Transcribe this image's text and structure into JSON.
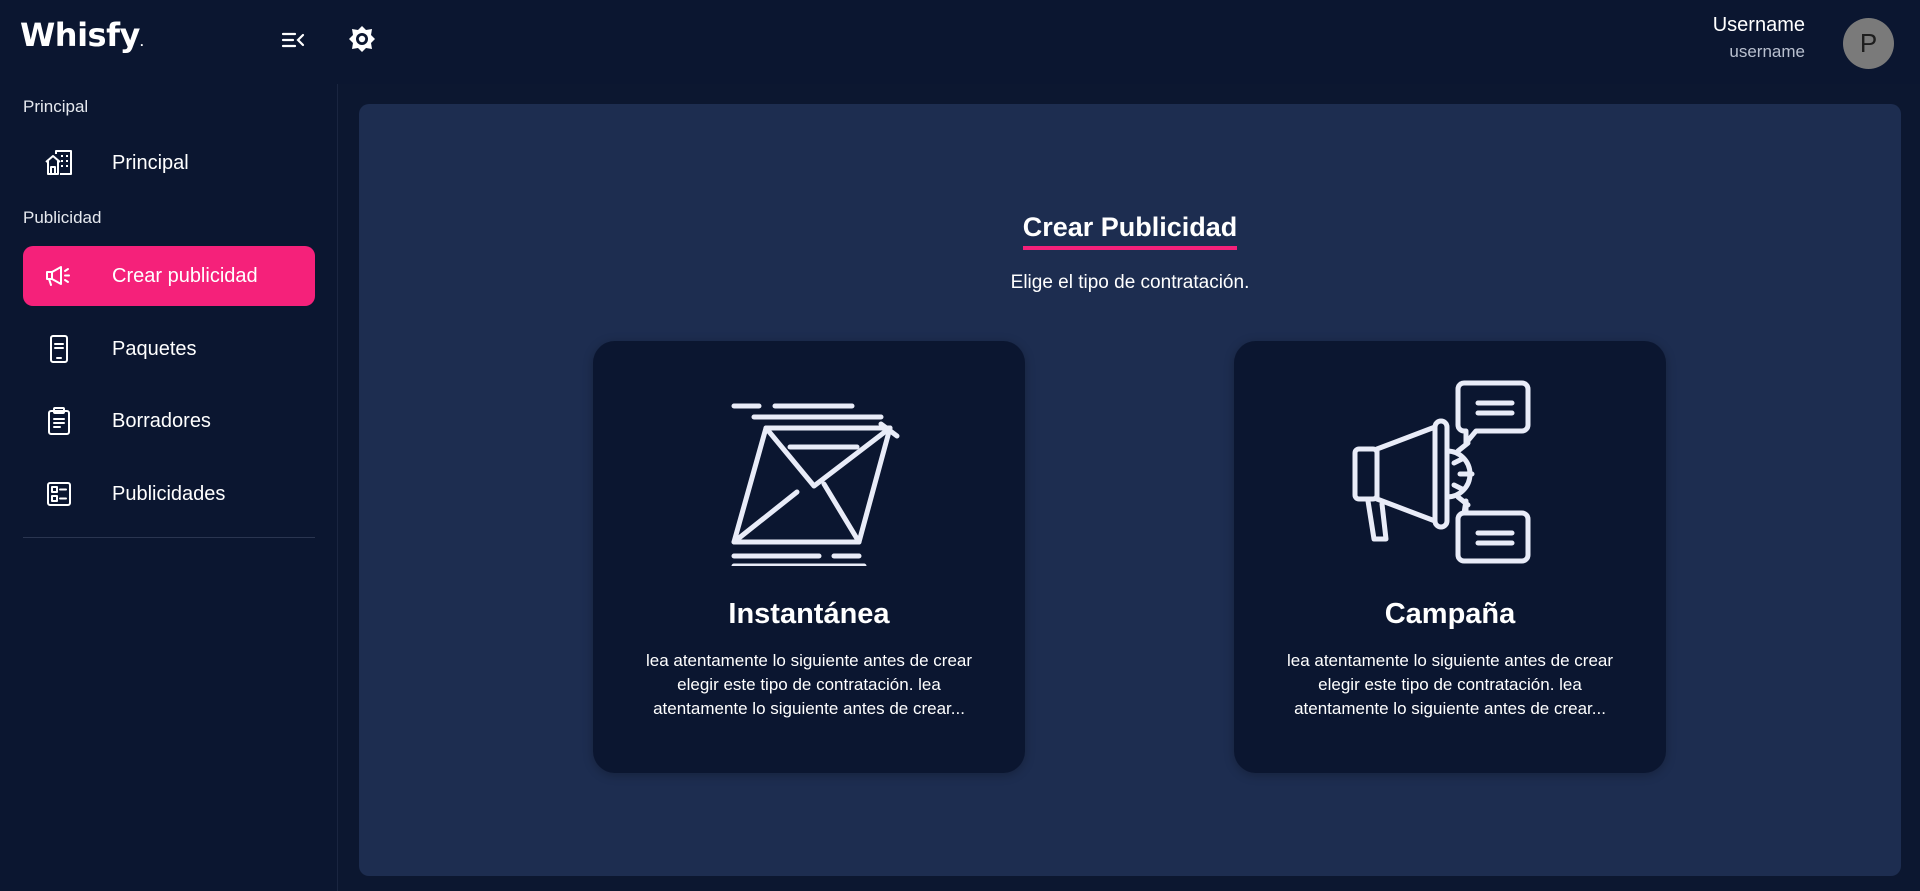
{
  "app": {
    "logo_text": "Whisfy",
    "logo_dot": "."
  },
  "header": {
    "menu_icon": "menu-collapse-icon",
    "theme_icon": "brightness-icon",
    "user_name": "Username",
    "user_handle": "username",
    "avatar_initial": "P"
  },
  "sidebar": {
    "sections": [
      {
        "label": "Principal"
      },
      {
        "label": "Publicidad"
      }
    ],
    "items": [
      {
        "label": "Principal",
        "icon": "home-building-icon",
        "active": false
      },
      {
        "label": "Crear publicidad",
        "icon": "megaphone-icon",
        "active": true
      },
      {
        "label": "Paquetes",
        "icon": "phone-document-icon",
        "active": false
      },
      {
        "label": "Borradores",
        "icon": "clipboard-icon",
        "active": false
      },
      {
        "label": "Publicidades",
        "icon": "list-checks-icon",
        "active": false
      }
    ]
  },
  "main": {
    "title": "Crear Publicidad",
    "subtitle": "Elige el tipo de contratación.",
    "cards": [
      {
        "title": "Instantánea",
        "icon": "envelope-fast-icon",
        "description": "lea atentamente lo siguiente antes de crear elegir este tipo de contratación. lea atentamente lo siguiente antes de crear..."
      },
      {
        "title": "Campaña",
        "icon": "megaphone-chat-icon",
        "description": "lea atentamente lo siguiente antes de crear elegir este tipo de contratación. lea atentamente lo siguiente antes de crear..."
      }
    ]
  },
  "colors": {
    "background": "#0b1630",
    "panel": "#1d2d50",
    "accent": "#f5217a",
    "text": "#ffffff"
  }
}
